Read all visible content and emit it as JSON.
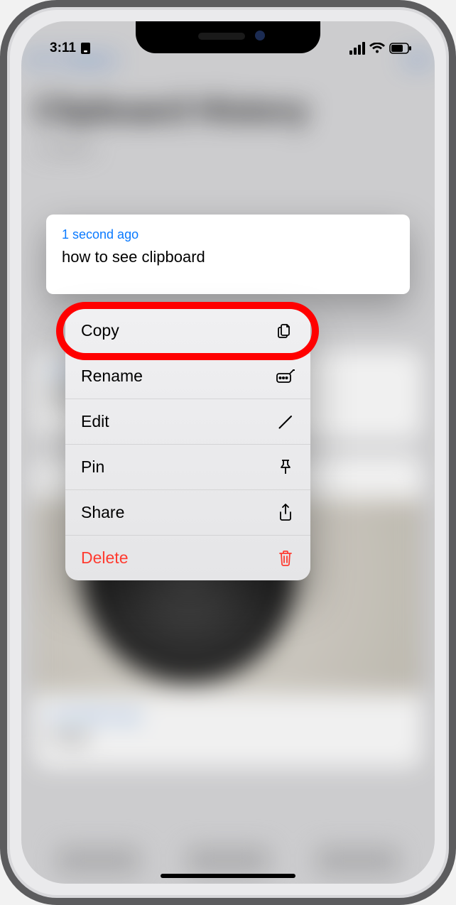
{
  "status_bar": {
    "time": "3:11"
  },
  "clipboard_card": {
    "timestamp": "1 second ago",
    "text": "how to see clipboard"
  },
  "context_menu": {
    "copy": "Copy",
    "rename": "Rename",
    "edit": "Edit",
    "pin": "Pin",
    "share": "Share",
    "delete": "Delete"
  }
}
